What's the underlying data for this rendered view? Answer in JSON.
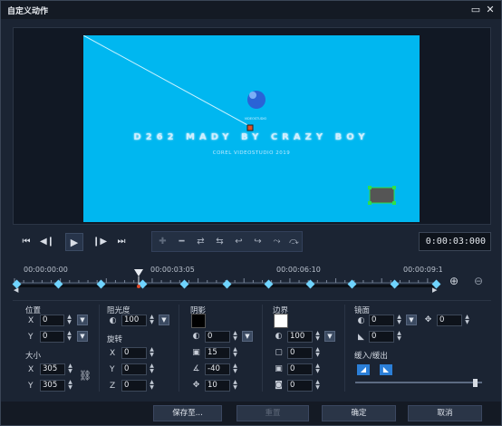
{
  "window": {
    "title": "自定义动作",
    "maximize_icon": "maximize-icon",
    "close_icon": "close-icon"
  },
  "preview": {
    "title_text": "D262 MADY BY CRAZY BOY",
    "subtitle_text": "COREL VIDEOSTUDIO 2019",
    "logo_text": "VIDEOSTUDIO",
    "background_color": "#00b7f0"
  },
  "transport": {
    "buttons": [
      "home-icon",
      "prev-frame-icon",
      "play-icon",
      "next-frame-icon",
      "end-icon"
    ],
    "keyframe_buttons": [
      "add-keyframe-icon",
      "remove-keyframe-icon",
      "reverse-icon",
      "move-left-icon",
      "move-right-icon",
      "prev-keyframe-icon",
      "next-keyframe-icon",
      "fade-icon"
    ],
    "timecode": "0:00:03:000"
  },
  "timeline": {
    "labels": [
      "00:00:00:00",
      "00:00:03:05",
      "00:00:06:10",
      "00:00:09:1"
    ],
    "keyframe_count": 11,
    "playhead_fraction": 0.29
  },
  "position": {
    "label": "位置",
    "x_label": "X",
    "x": "0",
    "y_label": "Y",
    "y": "0"
  },
  "size": {
    "label": "大小",
    "x_label": "X",
    "x": "305",
    "y_label": "Y",
    "y": "305"
  },
  "opacity": {
    "label": "阻光度",
    "value": "100"
  },
  "rotation": {
    "label": "旋转",
    "x_label": "X",
    "x": "0",
    "y_label": "Y",
    "y": "0",
    "z_label": "Z",
    "z": "0"
  },
  "shadow": {
    "label": "阴影",
    "color": "#000000",
    "opacity": "0",
    "blur": "15",
    "angle": "-40",
    "distance": "10"
  },
  "border": {
    "label": "边界",
    "color": "#ffffff",
    "opacity": "100",
    "width": "0",
    "blur": "0",
    "radius": "0"
  },
  "mirror": {
    "label": "镜面",
    "opacity": "0",
    "offset": "0",
    "distance": "0"
  },
  "ease": {
    "label": "缓入/缓出"
  },
  "footer": {
    "save_as": "保存至...",
    "reset": "重置",
    "ok": "确定",
    "cancel": "取消"
  }
}
